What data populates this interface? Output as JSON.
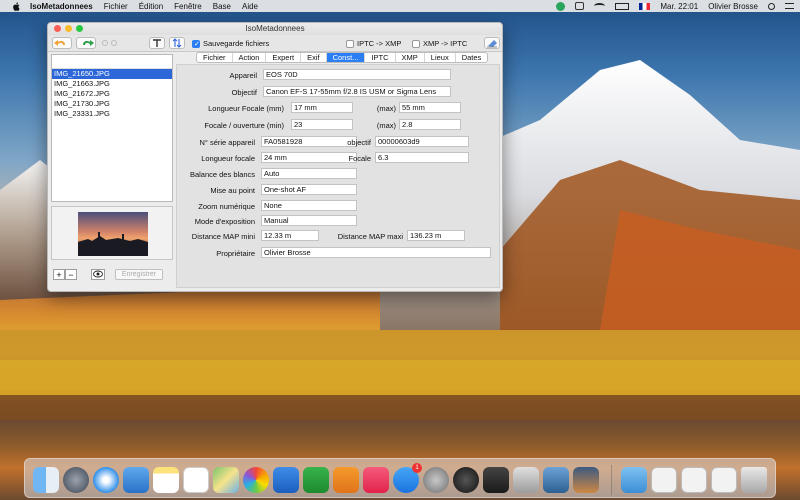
{
  "menubar": {
    "app_name": "IsoMetadonnees",
    "items": [
      "Fichier",
      "Édition",
      "Fenêtre",
      "Base",
      "Aide"
    ],
    "clock": "Mar. 22:01",
    "user": "Olivier Brosse"
  },
  "window": {
    "title": "IsoMetadonnees",
    "toolbar": {
      "save_files_label": "Sauvegarde fichiers",
      "save_files_checked": true,
      "iptc_to_xmp_label": "IPTC -> XMP",
      "xmp_to_iptc_label": "XMP -> IPTC"
    },
    "files": [
      "IMG_21650.JPG",
      "IMG_21663.JPG",
      "IMG_21672.JPG",
      "IMG_21730.JPG",
      "IMG_23331.JPG"
    ],
    "selected_file_index": 0,
    "add_label": "+",
    "remove_label": "−",
    "save_button": "Enregistrer",
    "tabs": [
      "Fichier",
      "Action",
      "Expert",
      "Exif",
      "Const...",
      "IPTC",
      "XMP",
      "Lieux",
      "Dates"
    ],
    "active_tab_index": 4,
    "fields": {
      "appareil_label": "Appareil",
      "appareil": "EOS 70D",
      "objectif_label": "Objectif",
      "objectif": "Canon EF-S 17-55mm f/2.8 IS USM or Sigma Lens",
      "longueur_focale_mm_label": "Longueur Focale (mm)",
      "longueur_focale_min": "17 mm",
      "max_label": "(max)",
      "longueur_focale_max": "55 mm",
      "focale_ouverture_label": "Focale / ouverture (min)",
      "ouverture_min": "23",
      "ouverture_max": "2.8",
      "serie_appareil_label": "N° série appareil",
      "serie_appareil": "FA0581928",
      "objectif_serie_label": "objectif",
      "objectif_serie": "00000603d9",
      "longueur_focale_label": "Longueur focale",
      "longueur_focale": "24 mm",
      "focale_label": "Focale",
      "focale": "6.3",
      "balance_blancs_label": "Balance des blancs",
      "balance_blancs": "Auto",
      "mise_au_point_label": "Mise au point",
      "mise_au_point": "One-shot AF",
      "zoom_numerique_label": "Zoom numérique",
      "zoom_numerique": "None",
      "mode_exposition_label": "Mode d'exposition",
      "mode_exposition": "Manual",
      "distance_map_mini_label": "Distance MAP mini",
      "distance_map_mini": "12.33 m",
      "distance_map_maxi_label": "Distance MAP maxi",
      "distance_map_maxi": "136.23 m",
      "proprietaire_label": "Propriétaire",
      "proprietaire": "Olivier Brosse"
    }
  },
  "dock": {
    "apps": [
      "finder-icon",
      "launchpad-icon",
      "safari-icon",
      "mail-icon",
      "notes-icon",
      "reminders-icon",
      "maps-icon",
      "photos-icon",
      "keynote-icon",
      "numbers-icon",
      "pages-icon",
      "music-icon",
      "app-store-icon",
      "system-preferences-icon",
      "iso-app-icon",
      "camera-icon",
      "preview-icon",
      "image-tool-icon",
      "photo-app-icon",
      "downloads-folder-icon",
      "document-icon",
      "document-icon-2",
      "document-icon-3",
      "trash-icon"
    ],
    "app_store_badge": "1"
  }
}
